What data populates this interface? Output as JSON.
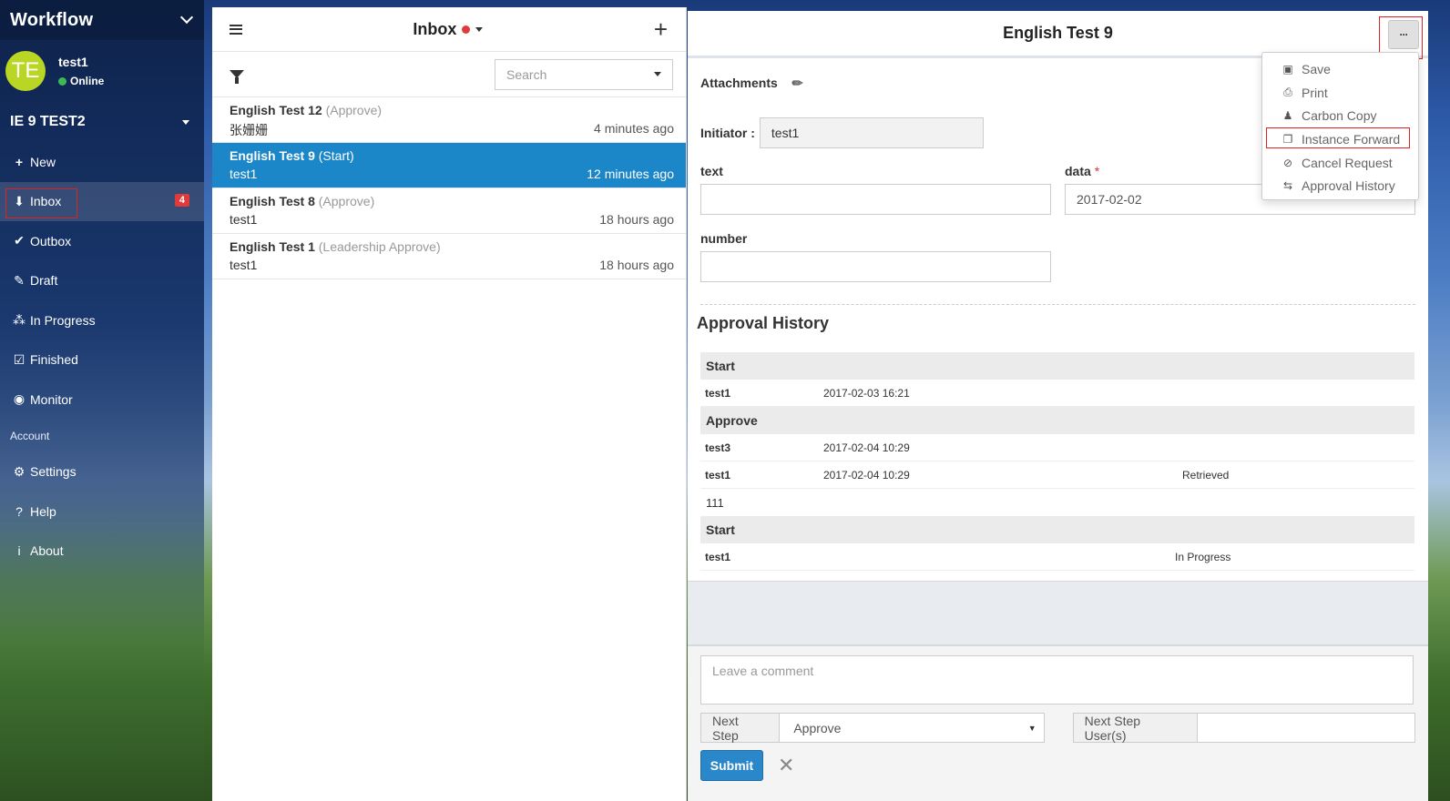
{
  "sidebar": {
    "app_title": "Workflow",
    "user": {
      "initials": "TE",
      "name": "test1",
      "status": "Online"
    },
    "space": "IE 9 TEST2",
    "nav": [
      {
        "label": "New",
        "icon": "plus-icon",
        "glyph": "+"
      },
      {
        "label": "Inbox",
        "icon": "inbox-icon",
        "glyph": "⬇",
        "badge": "4",
        "active": true
      },
      {
        "label": "Outbox",
        "icon": "double-check-icon",
        "glyph": "✔"
      },
      {
        "label": "Draft",
        "icon": "edit-icon",
        "glyph": "✎"
      },
      {
        "label": "In Progress",
        "icon": "spinner-icon",
        "glyph": "⁂"
      },
      {
        "label": "Finished",
        "icon": "checkbox-icon",
        "glyph": "☑"
      },
      {
        "label": "Monitor",
        "icon": "eye-icon",
        "glyph": "◉"
      }
    ],
    "account_label": "Account",
    "account_nav": [
      {
        "label": "Settings",
        "icon": "gear-icon",
        "glyph": "⚙"
      },
      {
        "label": "Help",
        "icon": "question-icon",
        "glyph": "?"
      },
      {
        "label": "About",
        "icon": "info-icon",
        "glyph": "i"
      }
    ]
  },
  "list": {
    "title": "Inbox",
    "search_placeholder": "Search",
    "items": [
      {
        "title": "English Test 12",
        "step": "(Approve)",
        "sub": "张姗姗",
        "time": "4 minutes ago"
      },
      {
        "title": "English Test 9",
        "step": "(Start)",
        "sub": "test1",
        "time": "12 minutes ago",
        "selected": true
      },
      {
        "title": "English Test 8",
        "step": "(Approve)",
        "sub": "test1",
        "time": "18 hours ago"
      },
      {
        "title": "English Test 1",
        "step": "(Leadership Approve)",
        "sub": "test1",
        "time": "18 hours ago"
      }
    ]
  },
  "detail": {
    "title": "English Test 9",
    "more_label": "···",
    "attachments_label": "Attachments",
    "initiator_label": "Initiator :",
    "initiator_value": "test1",
    "fields": {
      "text_label": "text",
      "text_value": "",
      "data_label": "data",
      "data_required": "*",
      "data_value": "2017-02-02",
      "number_label": "number",
      "number_value": ""
    },
    "history_title": "Approval History",
    "history": {
      "g1": "Start",
      "r1": {
        "user": "test1",
        "time": "2017-02-03 16:21",
        "status": ""
      },
      "g2": "Approve",
      "r2": {
        "user": "test3",
        "time": "2017-02-04 10:29",
        "status": ""
      },
      "r3": {
        "user": "test1",
        "time": "2017-02-04 10:29",
        "status": "Retrieved"
      },
      "comment": "111",
      "g3": "Start",
      "r4": {
        "user": "test1",
        "time": "",
        "status": "In Progress"
      }
    },
    "comment_placeholder": "Leave a comment",
    "next_step_label": "Next Step",
    "next_step_value": "Approve",
    "next_users_label": "Next Step User(s)",
    "next_users_value": "",
    "submit_label": "Submit"
  },
  "menu": [
    {
      "label": "Save",
      "icon": "save-icon",
      "glyph": "▣"
    },
    {
      "label": "Print",
      "icon": "print-icon",
      "glyph": "⎙"
    },
    {
      "label": "Carbon Copy",
      "icon": "user-plus-icon",
      "glyph": "♟"
    },
    {
      "label": "Instance Forward",
      "icon": "copy-icon",
      "glyph": "❐"
    },
    {
      "label": "Cancel Request",
      "icon": "ban-icon",
      "glyph": "⊘"
    },
    {
      "label": "Approval History",
      "icon": "history-icon",
      "glyph": "⇆"
    }
  ],
  "colors": {
    "accent": "#1b87c9",
    "badge": "#e03a3a",
    "highlight_box": "#dd2222"
  }
}
